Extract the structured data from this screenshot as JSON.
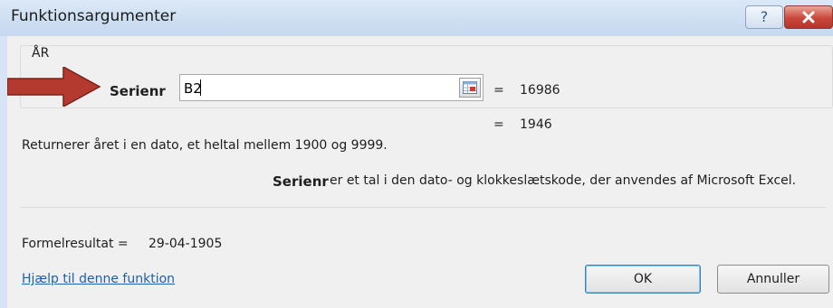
{
  "window": {
    "title": "Funktionsargumenter",
    "help_button": "?",
    "close_icon": "close-icon"
  },
  "function": {
    "name": "ÅR",
    "argument_label": "Serienr",
    "argument_value": "B2",
    "argument_result_prefix": "=",
    "argument_result": "16986",
    "function_result_prefix": "=",
    "function_result": "1946"
  },
  "description": "Returnerer året i en dato, et heltal mellem 1900 og 9999.",
  "argument_help": {
    "name": "Serienr",
    "text": "er et tal i den dato- og klokkeslætskode, der anvendes af Microsoft Excel."
  },
  "formula_result": {
    "label": "Formelresultat =",
    "value": "29-04-1905"
  },
  "help_link": "Hjælp til denne funktion",
  "buttons": {
    "ok": "OK",
    "cancel": "Annuller"
  },
  "colors": {
    "arrow": "#b43a2f",
    "link": "#1f5fb0",
    "close": "#c9463a"
  }
}
